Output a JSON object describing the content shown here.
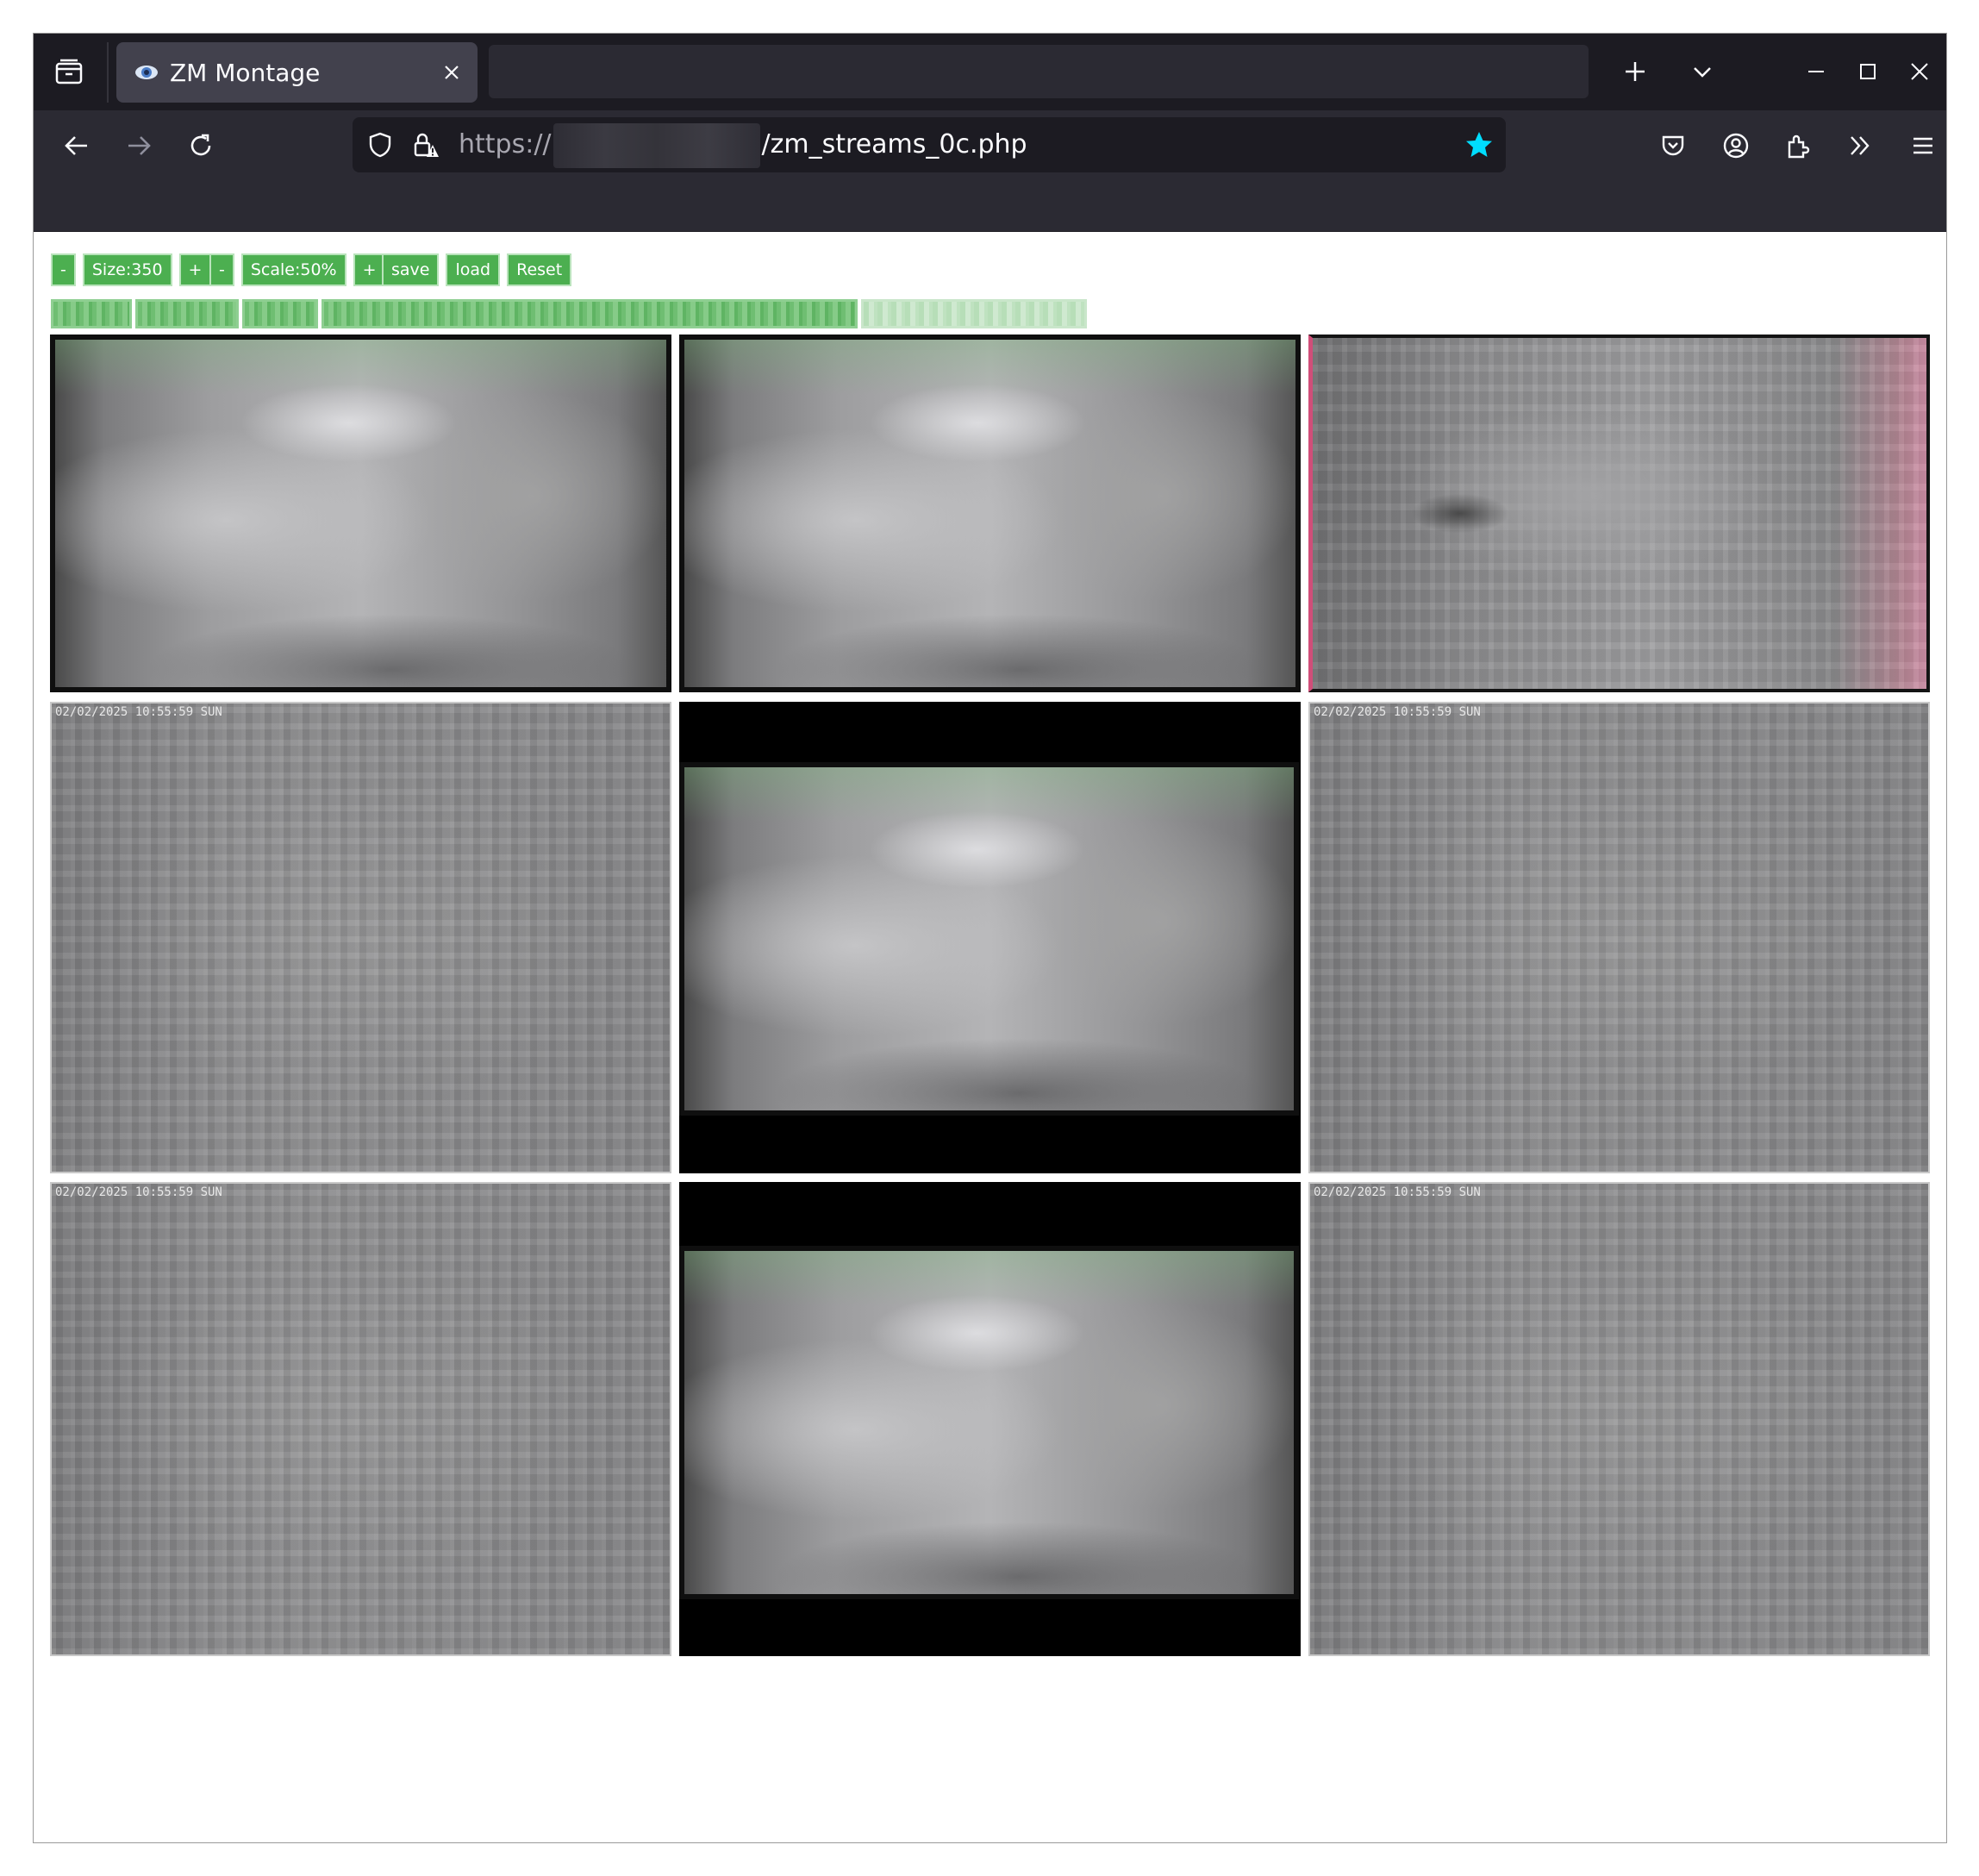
{
  "browser": {
    "tab_title": "ZM Montage",
    "url_scheme": "https://",
    "url_path": "/zm_streams_0c.php"
  },
  "icons": {
    "tab_list": "tab-list-icon",
    "favicon": "eye-icon",
    "close_tab": "close-icon",
    "new_tab": "plus-icon",
    "list_all_tabs": "chevron-down-icon",
    "minimize": "minimize-icon",
    "maximize": "maximize-icon",
    "close_window": "close-icon",
    "back": "back-arrow-icon",
    "forward": "forward-arrow-icon",
    "reload": "reload-icon",
    "tracking_protection": "shield-icon",
    "site_security": "insecure-lock-icon",
    "bookmark": "star-icon",
    "pocket": "pocket-icon",
    "account": "account-icon",
    "extensions": "puzzle-icon",
    "overflow": "double-chevron-icon",
    "app_menu": "hamburger-menu-icon"
  },
  "colors": {
    "accent_button": "#4caf50",
    "bookmark_star": "#00ddff",
    "chrome_dark": "#1c1b22"
  },
  "controls": {
    "size_minus": "-",
    "size_label": "Size:350",
    "size_plus": "+",
    "scale_minus": "-",
    "scale_label": "Scale:50%",
    "scale_plus": "+",
    "save": "save",
    "load": "load",
    "reset": "Reset"
  },
  "monitors": [
    {
      "timestamp": ""
    },
    {
      "timestamp": ""
    },
    {
      "timestamp": ""
    },
    {
      "timestamp": "02/02/2025 10:55:59 SUN"
    },
    {
      "timestamp": ""
    },
    {
      "timestamp": "02/02/2025 10:55:59 SUN"
    },
    {
      "timestamp": "02/02/2025 10:55:59 SUN"
    },
    {
      "timestamp": ""
    },
    {
      "timestamp": "02/02/2025 10:55:59 SUN"
    }
  ]
}
